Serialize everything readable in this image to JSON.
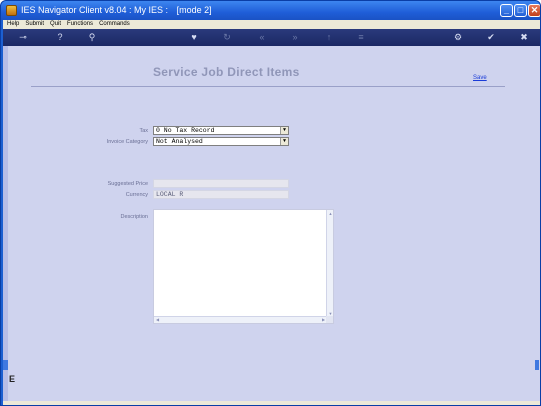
{
  "window": {
    "title_parts": [
      "IES Navigator Client v8.04 : My IES :",
      "[mode 2]"
    ],
    "min_glyph": "_",
    "max_glyph": "□",
    "close_glyph": "✕"
  },
  "menu": {
    "items": [
      "Help",
      "Submit",
      "Quit",
      "Functions",
      "Commands"
    ]
  },
  "toolbar": {
    "icons": [
      {
        "name": "key-icon",
        "glyph": "⊸"
      },
      {
        "name": "help-icon",
        "glyph": "?"
      },
      {
        "name": "search-icon",
        "glyph": "⚲"
      },
      {
        "name": "heart-icon",
        "glyph": "♥"
      },
      {
        "name": "refresh-icon",
        "glyph": "↻"
      },
      {
        "name": "first-icon",
        "glyph": "«"
      },
      {
        "name": "last-icon",
        "glyph": "»"
      },
      {
        "name": "nav-up-icon",
        "glyph": "↑"
      },
      {
        "name": "list-icon",
        "glyph": "≡"
      },
      {
        "name": "settings-icon",
        "glyph": "⚙"
      },
      {
        "name": "ok-icon",
        "glyph": "✔"
      },
      {
        "name": "cancel-icon",
        "glyph": "✖"
      }
    ]
  },
  "page": {
    "title": "Service Job Direct Items",
    "save_label": "Save"
  },
  "form": {
    "tax_label": "Tax",
    "tax_value": "0 No Tax Record",
    "invoice_category_label": "Invoice Category",
    "invoice_category_value": "Not Analysed",
    "suggested_price_label": "Suggested Price",
    "suggested_price_value": "",
    "currency_label": "Currency",
    "currency_value": "LOCAL R",
    "description_label": "Description",
    "description_value": ""
  },
  "side": {
    "letter": "E"
  },
  "colors": {
    "titlebar": "#1f5ed8",
    "toolbar": "#1b2864",
    "content_bg": "#cfd3ee",
    "save_link": "#1a3bd8"
  }
}
